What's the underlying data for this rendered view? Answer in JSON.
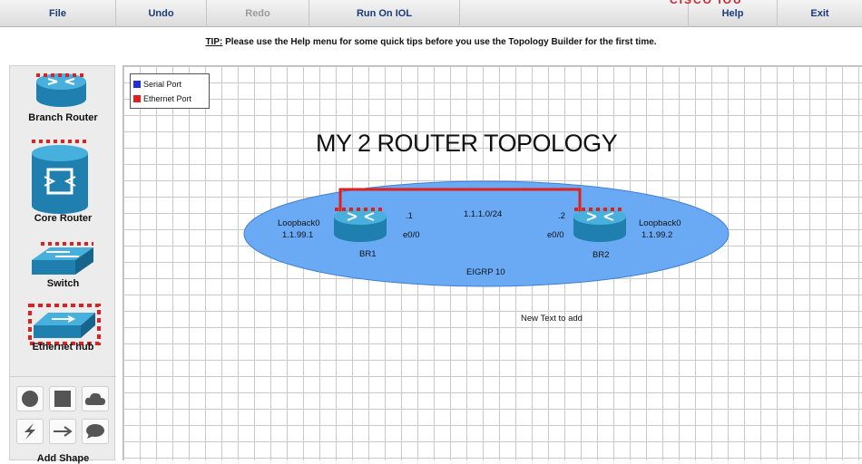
{
  "menu": {
    "file": "File",
    "undo": "Undo",
    "redo": "Redo",
    "run_on_iol": "Run On IOL",
    "help": "Help",
    "exit": "Exit"
  },
  "tip": {
    "label": "TIP:",
    "text": " Please use the Help menu for some quick tips before you use the Topology Builder for the first time."
  },
  "palette": {
    "branch_router": "Branch Router",
    "core_router": "Core Router",
    "switch": "Switch",
    "ethernet_hub": "Ethernet hub",
    "add_shape": "Add Shape",
    "shape_icons": [
      "circle-icon",
      "square-icon",
      "cloud-icon",
      "lightning-icon",
      "arrow-icon",
      "speech-bubble-icon"
    ]
  },
  "legend": {
    "serial": {
      "label": "Serial Port",
      "color": "#1f2fe0"
    },
    "ethernet": {
      "label": "Ethernet Port",
      "color": "#e01f1f"
    }
  },
  "topology": {
    "title": "MY 2 ROUTER TOPOLOGY",
    "area_label": "EIGRP 10",
    "area_color": "#6aaaf5",
    "link_color": "#e01f1f",
    "subnet": "1.1.1.0/24",
    "free_text": "New Text to add",
    "br1": {
      "name": "BR1",
      "loopback_label": "Loopback0",
      "loopback_ip": "1.1.99.1",
      "host_octet": ".1",
      "interface": "e0/0"
    },
    "br2": {
      "name": "BR2",
      "loopback_label": "Loopback0",
      "loopback_ip": "1.1.99.2",
      "host_octet": ".2",
      "interface": "e0/0"
    }
  }
}
